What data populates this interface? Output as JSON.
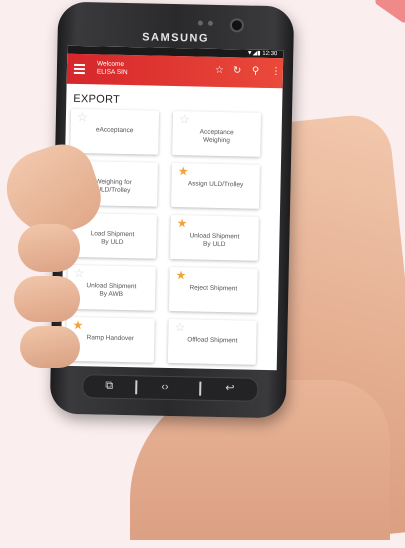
{
  "device": {
    "brand": "SAMSUNG"
  },
  "status_bar": {
    "time": "12:30",
    "signal_icons": "▼◢▮"
  },
  "app_bar": {
    "menu_icon": "hamburger-icon",
    "welcome_line1": "Welcome",
    "welcome_line2": "ELISA SIN",
    "actions": [
      "star-icon",
      "refresh-icon",
      "search-icon",
      "more-vert-icon"
    ],
    "color": "#d6262b"
  },
  "section_title": "EXPORT",
  "tiles": [
    {
      "label": "eAcceptance",
      "favorite": false
    },
    {
      "label": "Acceptance\nWeighing",
      "favorite": false
    },
    {
      "label": "Weighing for\nULD/Trolley",
      "favorite": false
    },
    {
      "label": "Assign ULD/Trolley",
      "favorite": true
    },
    {
      "label": "Load Shipment\nBy ULD",
      "favorite": true
    },
    {
      "label": "Unload Shipment\nBy ULD",
      "favorite": true
    },
    {
      "label": "Unload Shipment\nBy AWB",
      "favorite": false
    },
    {
      "label": "Reject Shipment",
      "favorite": true
    },
    {
      "label": "Ramp Handover",
      "favorite": true
    },
    {
      "label": "Offload Shipment",
      "favorite": false
    }
  ],
  "colors": {
    "star_on": "#f2a23a",
    "star_off": "#d8d8d8"
  },
  "nav_buttons": [
    "recent-apps-icon",
    "home-icon",
    "back-icon"
  ]
}
